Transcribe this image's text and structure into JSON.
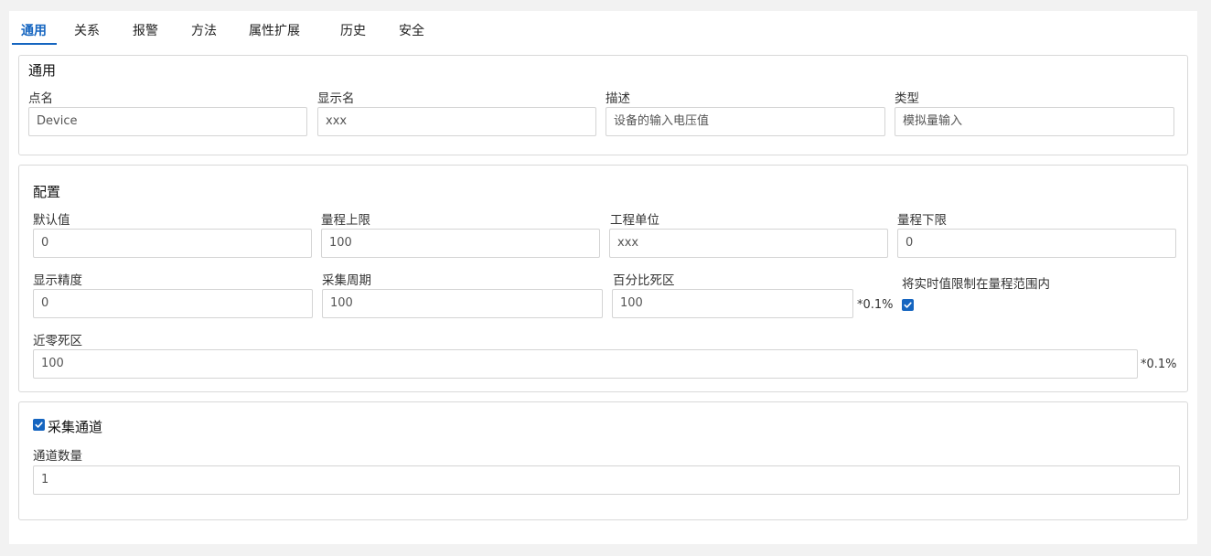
{
  "tabs": [
    "通用",
    "关系",
    "报警",
    "方法",
    "属性扩展",
    "历史",
    "安全"
  ],
  "general": {
    "title": "通用",
    "fields": [
      {
        "label": "点名",
        "value": "Device"
      },
      {
        "label": "显示名",
        "value": "xxx"
      },
      {
        "label": "描述",
        "value": "设备的输入电压值"
      },
      {
        "label": "类型",
        "value": "模拟量输入"
      }
    ]
  },
  "config": {
    "title": "配置",
    "row1": [
      {
        "label": "默认值",
        "value": "0"
      },
      {
        "label": "量程上限",
        "value": "100"
      },
      {
        "label": "工程单位",
        "value": "xxx"
      },
      {
        "label": "量程下限",
        "value": "0"
      }
    ],
    "row2": [
      {
        "label": "显示精度",
        "value": "0"
      },
      {
        "label": "采集周期",
        "value": "100"
      },
      {
        "label": "百分比死区",
        "value": "100",
        "suffix": "*0.1%"
      }
    ],
    "clamp_label": "将实时值限制在量程范围内",
    "clamp_checked": true,
    "near_zero": {
      "label": "近零死区",
      "value": "100",
      "suffix": "*0.1%"
    }
  },
  "channel": {
    "title": "采集通道",
    "checked": true,
    "count_label": "通道数量",
    "count_value": "1"
  },
  "colors": {
    "accent": "#1565c0",
    "border": "#d9d9d9",
    "background": "#f2f2f2"
  }
}
